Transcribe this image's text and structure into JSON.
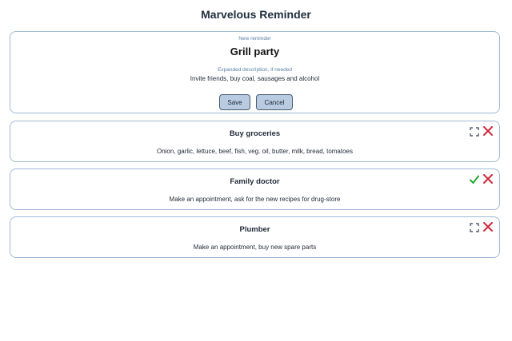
{
  "app": {
    "title": "Marvelous Reminder"
  },
  "new_reminder": {
    "heading": "New reminder",
    "title_value": "Grill party",
    "description_label": "Expanded description, if needed",
    "description_value": "Invite friends, buy coal, sausages and alcohol",
    "save_label": "Save",
    "cancel_label": "Cancel"
  },
  "reminders": [
    {
      "title": "Buy groceries",
      "description": "Onion, garlic, lettuce, beef, fish, veg. oil, butter, milk, bread, tomatoes",
      "status_icon": "expand-icon",
      "delete_icon": "close-icon"
    },
    {
      "title": "Family doctor",
      "description": "Make an appointment, ask for the new recipes for drug-store",
      "status_icon": "checkmark-icon",
      "delete_icon": "close-icon"
    },
    {
      "title": "Plumber",
      "description": "Make an appointment, buy new spare parts",
      "status_icon": "expand-icon",
      "delete_icon": "close-icon"
    }
  ],
  "colors": {
    "border": "#9fb8d3",
    "button_bg": "#b8cbe0",
    "check": "#22a832",
    "delete": "#d1283b",
    "label": "#5b7fa8"
  }
}
